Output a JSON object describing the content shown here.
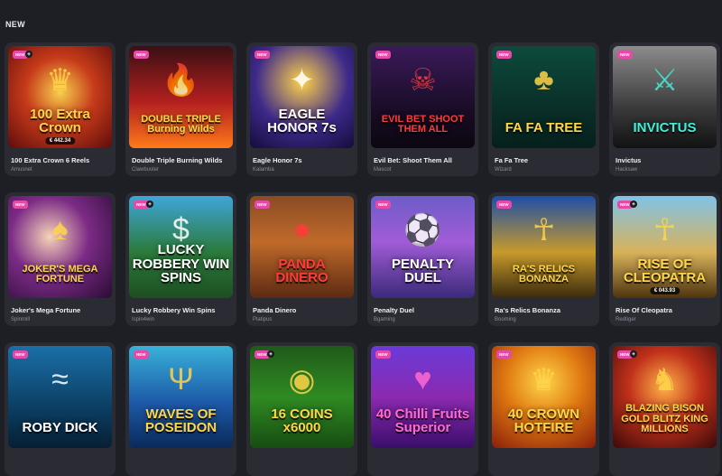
{
  "section": {
    "title": "NEW"
  },
  "badges": {
    "new": "NEW"
  },
  "games": [
    {
      "name": "100 Extra Crown 6 Reels",
      "provider": "Amusnet",
      "art_title": "100 Extra Crown",
      "jackpot": "€ 442.34",
      "icon": "crown-icon",
      "chip": true
    },
    {
      "name": "Double Triple Burning Wilds",
      "provider": "Clawbuster",
      "art_title": "DOUBLE TRIPLE Burning Wilds",
      "jackpot": "",
      "icon": "fire-icon",
      "chip": false
    },
    {
      "name": "Eagle Honor 7s",
      "provider": "Kalamba",
      "art_title": "EAGLE HONOR 7s",
      "jackpot": "",
      "icon": "eagle-icon",
      "chip": false
    },
    {
      "name": "Evil Bet: Shoot Them All",
      "provider": "Mascot",
      "art_title": "EVIL BET SHOOT THEM ALL",
      "jackpot": "",
      "icon": "skull-icon",
      "chip": false
    },
    {
      "name": "Fa Fa Tree",
      "provider": "Wizard",
      "art_title": "FA FA TREE",
      "jackpot": "",
      "icon": "tree-icon",
      "chip": false
    },
    {
      "name": "Invictus",
      "provider": "Hacksaw",
      "art_title": "INVICTUS",
      "jackpot": "",
      "icon": "helmet-icon",
      "chip": false
    },
    {
      "name": "Joker's Mega Fortune",
      "provider": "Spinmill",
      "art_title": "JOKER'S MEGA FORTUNE",
      "jackpot": "",
      "icon": "joker-icon",
      "chip": false
    },
    {
      "name": "Lucky Robbery Win Spins",
      "provider": "Ispin4win",
      "art_title": "LUCKY ROBBERY WIN SPINS",
      "jackpot": "",
      "icon": "money-bag-icon",
      "chip": true
    },
    {
      "name": "Panda Dinero",
      "provider": "Platipus",
      "art_title": "PANDA DINERO",
      "jackpot": "",
      "icon": "panda-icon",
      "chip": false
    },
    {
      "name": "Penalty Duel",
      "provider": "Bgaming",
      "art_title": "PENALTY DUEL",
      "jackpot": "",
      "icon": "soccer-ball-icon",
      "chip": false
    },
    {
      "name": "Ra's Relics Bonanza",
      "provider": "Booming",
      "art_title": "RA'S RELICS BONANZA",
      "jackpot": "",
      "icon": "pharaoh-icon",
      "chip": false
    },
    {
      "name": "Rise Of Cleopatra",
      "provider": "Redtiger",
      "art_title": "RISE OF CLEOPATRA",
      "jackpot": "€ 043.93",
      "icon": "cleopatra-icon",
      "chip": true
    },
    {
      "name": "",
      "provider": "",
      "art_title": "ROBY DICK",
      "jackpot": "",
      "icon": "whale-icon",
      "chip": false
    },
    {
      "name": "",
      "provider": "",
      "art_title": "WAVES OF POSEIDON",
      "jackpot": "",
      "icon": "trident-icon",
      "chip": false
    },
    {
      "name": "",
      "provider": "",
      "art_title": "16 COINS x6000",
      "jackpot": "",
      "icon": "coin-icon",
      "chip": true
    },
    {
      "name": "",
      "provider": "",
      "art_title": "40 Chilli Fruits Superior",
      "jackpot": "",
      "icon": "chili-icon",
      "chip": false
    },
    {
      "name": "",
      "provider": "",
      "art_title": "40 CROWN HOTFIRE",
      "jackpot": "",
      "icon": "crown-icon",
      "chip": false
    },
    {
      "name": "",
      "provider": "",
      "art_title": "BLAZING BISON GOLD BLITZ KING MILLIONS",
      "jackpot": "",
      "icon": "bison-icon",
      "chip": true
    }
  ]
}
